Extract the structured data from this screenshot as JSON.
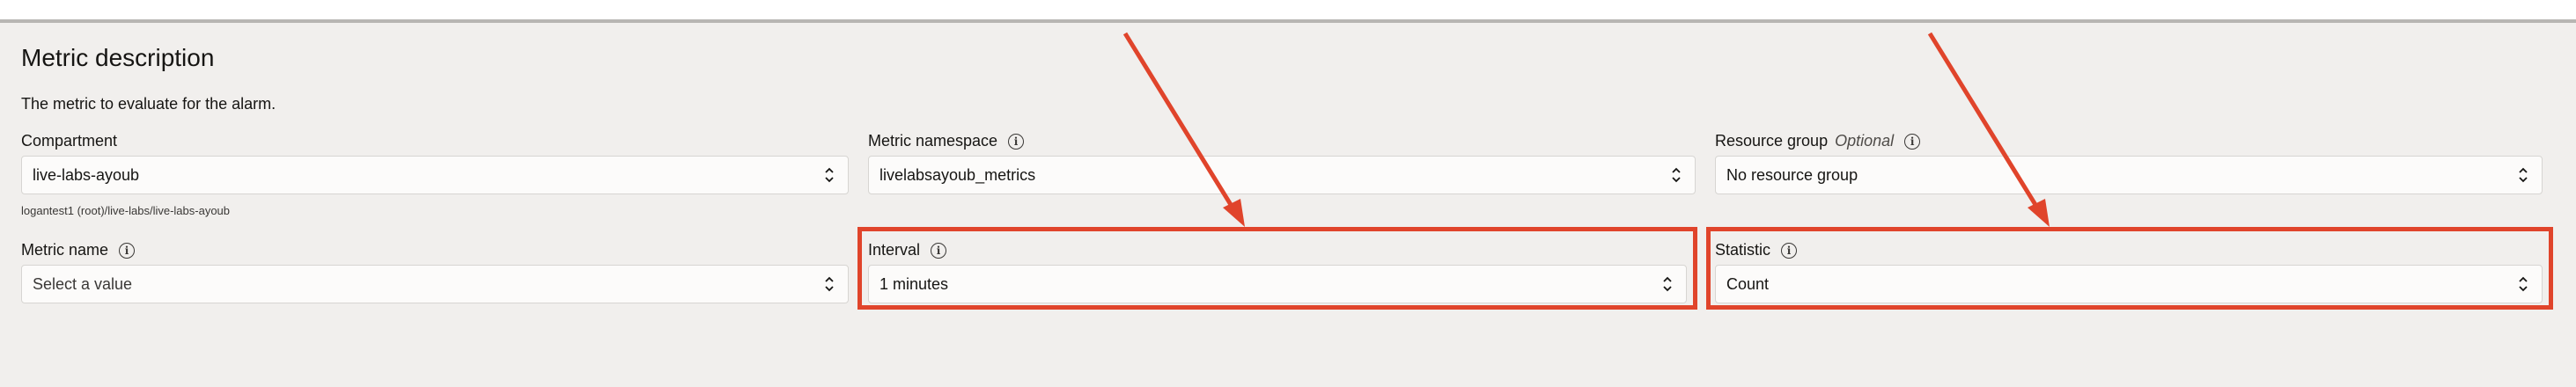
{
  "section": {
    "title": "Metric description",
    "description": "The metric to evaluate for the alarm."
  },
  "fields": {
    "compartment": {
      "label": "Compartment",
      "value": "live-labs-ayoub",
      "helper": "logantest1 (root)/live-labs/live-labs-ayoub"
    },
    "metric_namespace": {
      "label": "Metric namespace",
      "value": "livelabsayoub_metrics"
    },
    "resource_group": {
      "label": "Resource group",
      "optional_tag": "Optional",
      "value": "No resource group"
    },
    "metric_name": {
      "label": "Metric name",
      "placeholder": "Select a value"
    },
    "interval": {
      "label": "Interval",
      "value": "1 minutes"
    },
    "statistic": {
      "label": "Statistic",
      "value": "Count"
    }
  },
  "icons": {
    "info": "info-icon",
    "select_arrows": "chevron-up-down-icon"
  },
  "colors": {
    "annotation": "#e0442b",
    "background": "#f1efed"
  }
}
